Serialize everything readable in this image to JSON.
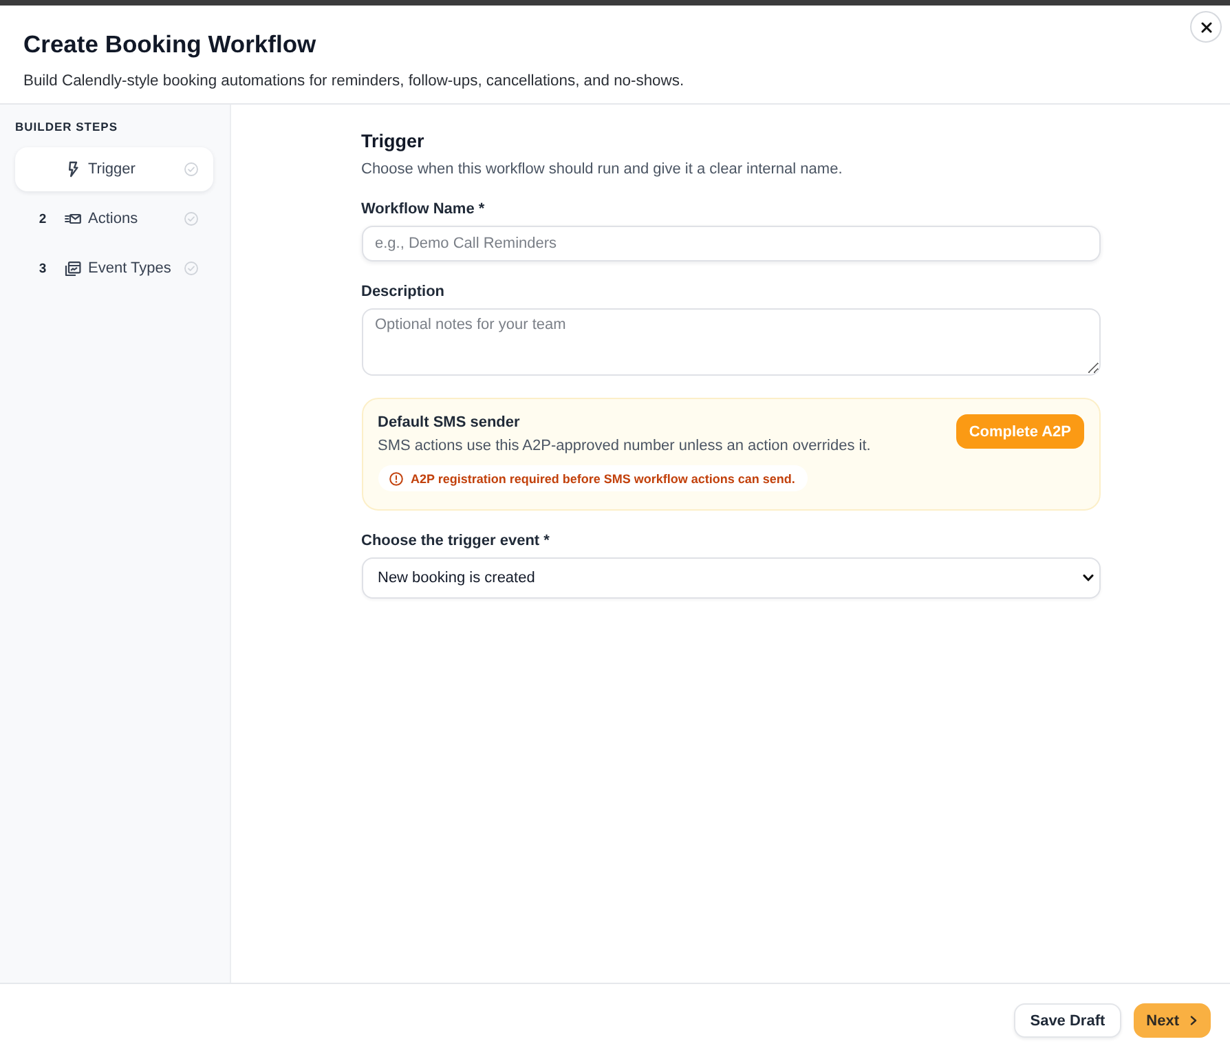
{
  "window": {
    "title": "Create Booking Workflow",
    "subtitle": "Build Calendly-style booking automations for reminders, follow-ups, cancellations, and no-shows."
  },
  "sidebar": {
    "heading": "BUILDER STEPS",
    "steps": [
      {
        "label": "Trigger",
        "selected": true
      },
      {
        "number": "2",
        "label": "Actions",
        "selected": false
      },
      {
        "number": "3",
        "label": "Event Types",
        "selected": false
      }
    ]
  },
  "form": {
    "title": "Trigger",
    "description": "Choose when this workflow should run and give it a clear internal name.",
    "items": [
      {
        "kind": "text",
        "label": "Workflow Name *",
        "placeholder": "e.g., Demo Call Reminders"
      },
      {
        "kind": "textarea",
        "label": "Description",
        "placeholder": "Optional notes for your team"
      },
      {
        "kind": "notice",
        "title": "Default SMS sender",
        "text": "SMS actions use this A2P-approved number unless an action overrides it.",
        "warning": "A2P registration required before SMS workflow actions can send.",
        "button": "Complete A2P"
      },
      {
        "kind": "select",
        "label": "Choose the trigger event *",
        "value": "New booking is created"
      }
    ]
  },
  "footer": {
    "buttons": [
      {
        "kind": "secondary",
        "label": "Save Draft"
      },
      {
        "kind": "primary",
        "label": "Next"
      }
    ]
  }
}
